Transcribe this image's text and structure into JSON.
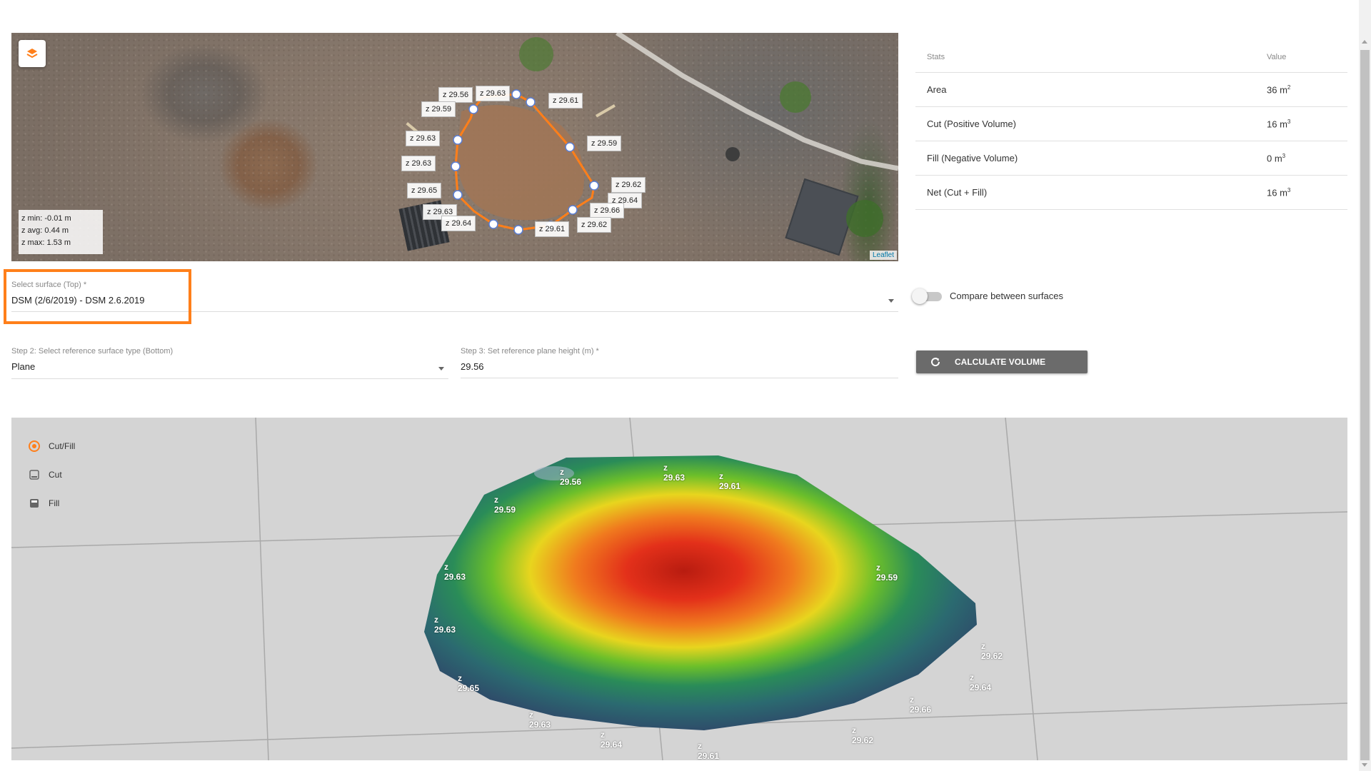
{
  "map": {
    "stats": {
      "zmin": "z min: -0.01 m",
      "zavg": "z avg: 0.44 m",
      "zmax": "z max: 1.53 m"
    },
    "labels": [
      "z 29.56",
      "z 29.63",
      "z 29.61",
      "z 29.59",
      "z 29.63",
      "z 29.63",
      "z 29.59",
      "z 29.65",
      "z 29.62",
      "z 29.64",
      "z 29.66",
      "z 29.63",
      "z 29.64",
      "z 29.61",
      "z 29.62"
    ],
    "attribution": "Leaflet"
  },
  "stats": {
    "header_name": "Stats",
    "header_value": "Value",
    "rows": [
      {
        "name": "Area",
        "value": "36 m",
        "sup": "2"
      },
      {
        "name": "Cut (Positive Volume)",
        "value": "16 m",
        "sup": "3"
      },
      {
        "name": "Fill (Negative Volume)",
        "value": "0 m",
        "sup": "3"
      },
      {
        "name": "Net (Cut + Fill)",
        "value": "16 m",
        "sup": "3"
      }
    ]
  },
  "form": {
    "surface_label": "Select surface (Top) *",
    "surface_value": "DSM (2/6/2019) - DSM 2.6.2019",
    "compare_label": "Compare between surfaces",
    "step2_label": "Step 2: Select reference surface type (Bottom)",
    "step2_value": "Plane",
    "step3_label": "Step 3: Set reference plane height (m) *",
    "step3_value": "29.56",
    "calculate_label": "CALCULATE VOLUME"
  },
  "view3d": {
    "legend": [
      {
        "label": "Cut/Fill",
        "selected": true
      },
      {
        "label": "Cut",
        "selected": false
      },
      {
        "label": "Fill",
        "selected": false
      }
    ],
    "z_letter": "z",
    "labels": [
      "29.56",
      "29.63",
      "29.61",
      "29.59",
      "29.63",
      "29.59",
      "29.63",
      "29.62",
      "29.64",
      "29.65",
      "29.66",
      "29.63",
      "29.62",
      "29.64",
      "29.61"
    ]
  },
  "colors": {
    "accent": "#ff7f1a",
    "button": "#6b6b6b",
    "view_bg": "#d4d4d4"
  }
}
